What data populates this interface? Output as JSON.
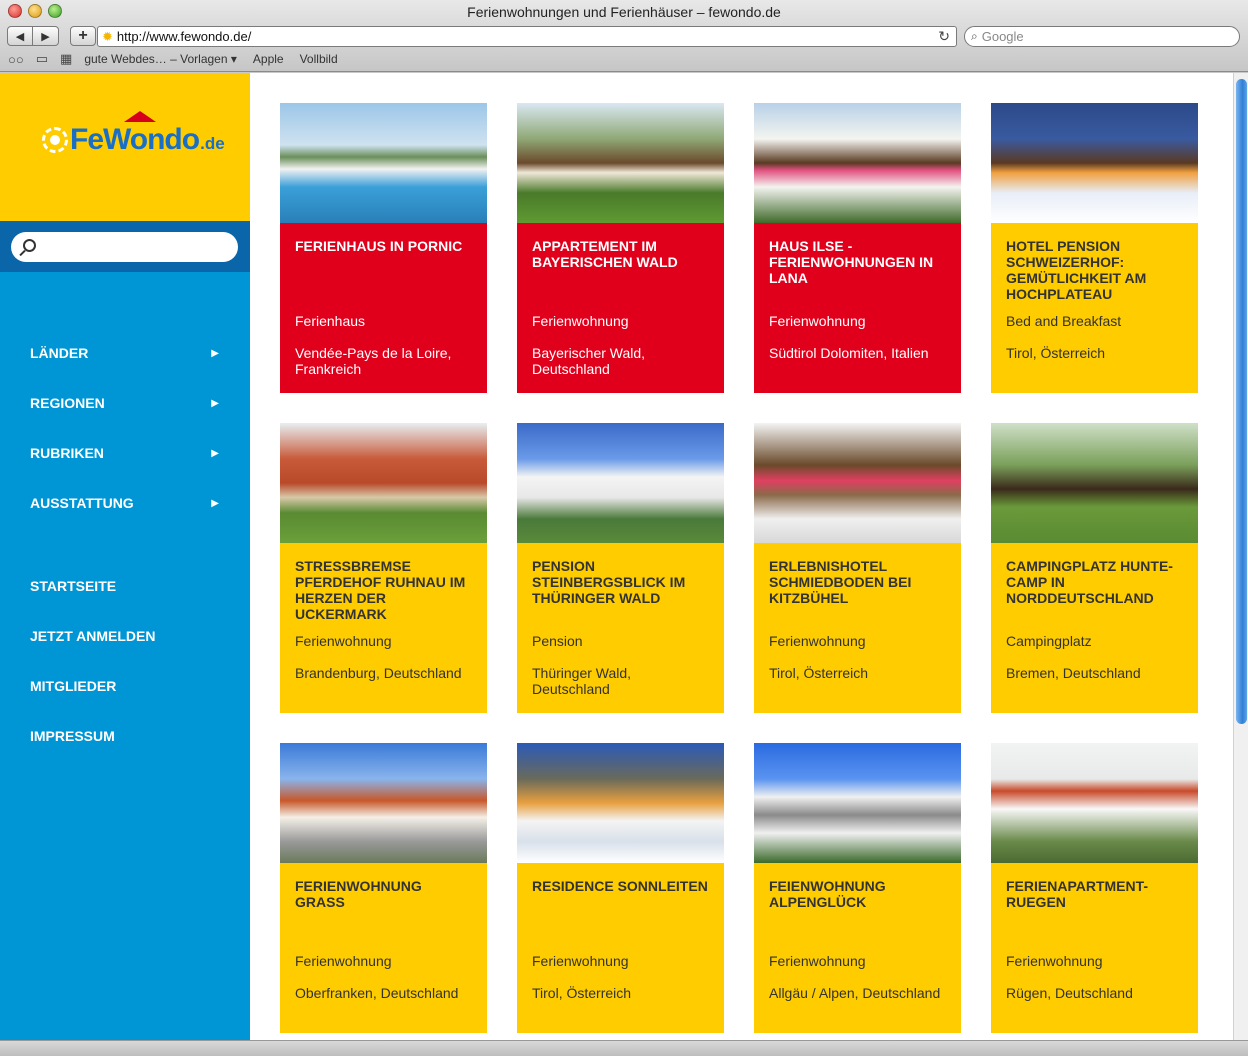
{
  "window": {
    "title": "Ferienwohnungen und Ferienhäuser – fewondo.de"
  },
  "toolbar": {
    "back_icon": "◀",
    "forward_icon": "▶",
    "add_icon": "+",
    "url": "http://www.fewondo.de/",
    "search_placeholder": "Google"
  },
  "bookmarks": [
    {
      "label": "gute Webdes… – Vorlagen ▾"
    },
    {
      "label": "Apple"
    },
    {
      "label": "Vollbild"
    }
  ],
  "site": {
    "logo_main": "FeWondo",
    "logo_tld": ".de"
  },
  "nav_primary": [
    {
      "label": "LÄNDER",
      "arrow": "▶"
    },
    {
      "label": "REGIONEN",
      "arrow": "▶"
    },
    {
      "label": "RUBRIKEN",
      "arrow": "▶"
    },
    {
      "label": "AUSSTATTUNG",
      "arrow": "▶"
    }
  ],
  "nav_secondary": [
    {
      "label": "STARTSEITE"
    },
    {
      "label": "JETZT ANMELDEN"
    },
    {
      "label": "MITGLIEDER"
    },
    {
      "label": "IMPRESSUM"
    }
  ],
  "colors": {
    "sidebar": "#0096d6",
    "logo_bg": "#ffcc00",
    "card_red": "#e0001b",
    "card_yellow": "#ffcc00"
  },
  "listings": [
    {
      "title": "FERIENHAUS IN PORNIC",
      "type": "Ferienhaus",
      "location": "Vendée-Pays de la Loire, Frankreich",
      "style": "red",
      "image": "pool-house-photo"
    },
    {
      "title": "APPARTEMENT IM BAYERISCHEN WALD",
      "type": "Ferienwohnung",
      "location": "Bayerischer Wald, Deutschland",
      "style": "red",
      "image": "chalet-photo"
    },
    {
      "title": "HAUS ILSE - FERIENWOHNUNGEN IN LANA",
      "type": "Ferienwohnung",
      "location": "Südtirol Dolomiten, Italien",
      "style": "red",
      "image": "balcony-flowers-photo"
    },
    {
      "title": "HOTEL PENSION SCHWEIZERHOF: GEMÜTLICHKEIT AM HOCHPLATEAU",
      "type": "Bed and Breakfast",
      "location": "Tirol, Österreich",
      "style": "yellow",
      "image": "winter-hotel-photo"
    },
    {
      "title": "STRESSBREMSE PFERDEHOF RUHNAU IM HERZEN DER UCKERMARK",
      "type": "Ferienwohnung",
      "location": "Brandenburg, Deutschland",
      "style": "yellow",
      "image": "farmhouse-photo"
    },
    {
      "title": "PENSION STEINBERGSBLICK IM THÜRINGER WALD",
      "type": "Pension",
      "location": "Thüringer Wald, Deutschland",
      "style": "yellow",
      "image": "pension-photo"
    },
    {
      "title": "ERLEBNISHOTEL SCHMIEDBODEN BEI KITZBÜHEL",
      "type": "Ferienwohnung",
      "location": "Tirol, Österreich",
      "style": "yellow",
      "image": "alpine-hotel-photo"
    },
    {
      "title": "CAMPINGPLATZ HUNTE-CAMP IN NORDDEUTSCHLAND",
      "type": "Campingplatz",
      "location": "Bremen, Deutschland",
      "style": "yellow",
      "image": "horses-sign-photo"
    },
    {
      "title": "FERIENWOHNUNG GRAß",
      "type": "Ferienwohnung",
      "location": "Oberfranken, Deutschland",
      "style": "yellow",
      "image": "white-house-photo"
    },
    {
      "title": "RESIDENCE SONNLEITEN",
      "type": "Ferienwohnung",
      "location": "Tirol, Österreich",
      "style": "yellow",
      "image": "snow-residence-photo"
    },
    {
      "title": "FEIENWOHNUNG ALPENGLÜCK",
      "type": "Ferienwohnung",
      "location": "Allgäu / Alpen, Deutschland",
      "style": "yellow",
      "image": "apartment-block-photo"
    },
    {
      "title": "FERIENAPARTMENT-RUEGEN",
      "type": "Ferienwohnung",
      "location": "Rügen, Deutschland",
      "style": "yellow",
      "image": "villa-photo"
    }
  ]
}
